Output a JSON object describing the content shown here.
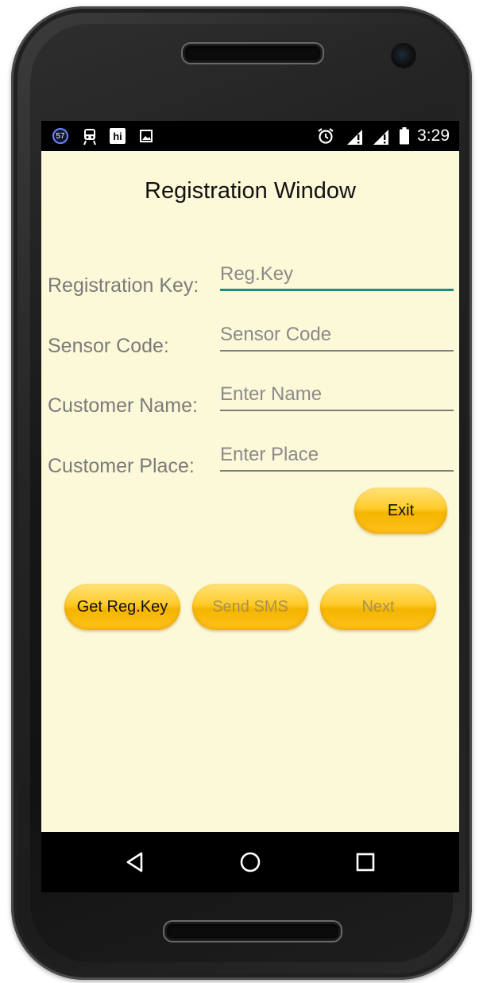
{
  "status_bar": {
    "notification_badge": "57",
    "left_icons": [
      "notification-57-icon",
      "train-icon",
      "hi-app-icon",
      "image-icon"
    ],
    "right_icons": [
      "alarm-icon",
      "signal-icon",
      "signal-icon",
      "battery-icon"
    ],
    "time": "3:29"
  },
  "app": {
    "title": "Registration Window",
    "background_color": "#fbf9d8",
    "fields": [
      {
        "label": "Registration Key:",
        "value": "",
        "placeholder": "Reg.Key",
        "focused": true
      },
      {
        "label": "Sensor Code:",
        "value": "",
        "placeholder": "Sensor Code",
        "focused": false
      },
      {
        "label": "Customer Name:",
        "value": "",
        "placeholder": "Enter Name",
        "focused": false
      },
      {
        "label": "Customer Place:",
        "value": "",
        "placeholder": "Enter Place",
        "focused": false
      }
    ],
    "buttons": {
      "exit": "Exit",
      "get_reg_key": "Get Reg.Key",
      "send_sms": "Send SMS",
      "next": "Next"
    },
    "disabled_buttons": [
      "send_sms",
      "next"
    ],
    "accent_color": "#1a8f7a",
    "button_color": "#ffc21c"
  },
  "nav_bar": {
    "icons": [
      "back-icon",
      "home-icon",
      "recents-icon"
    ]
  }
}
